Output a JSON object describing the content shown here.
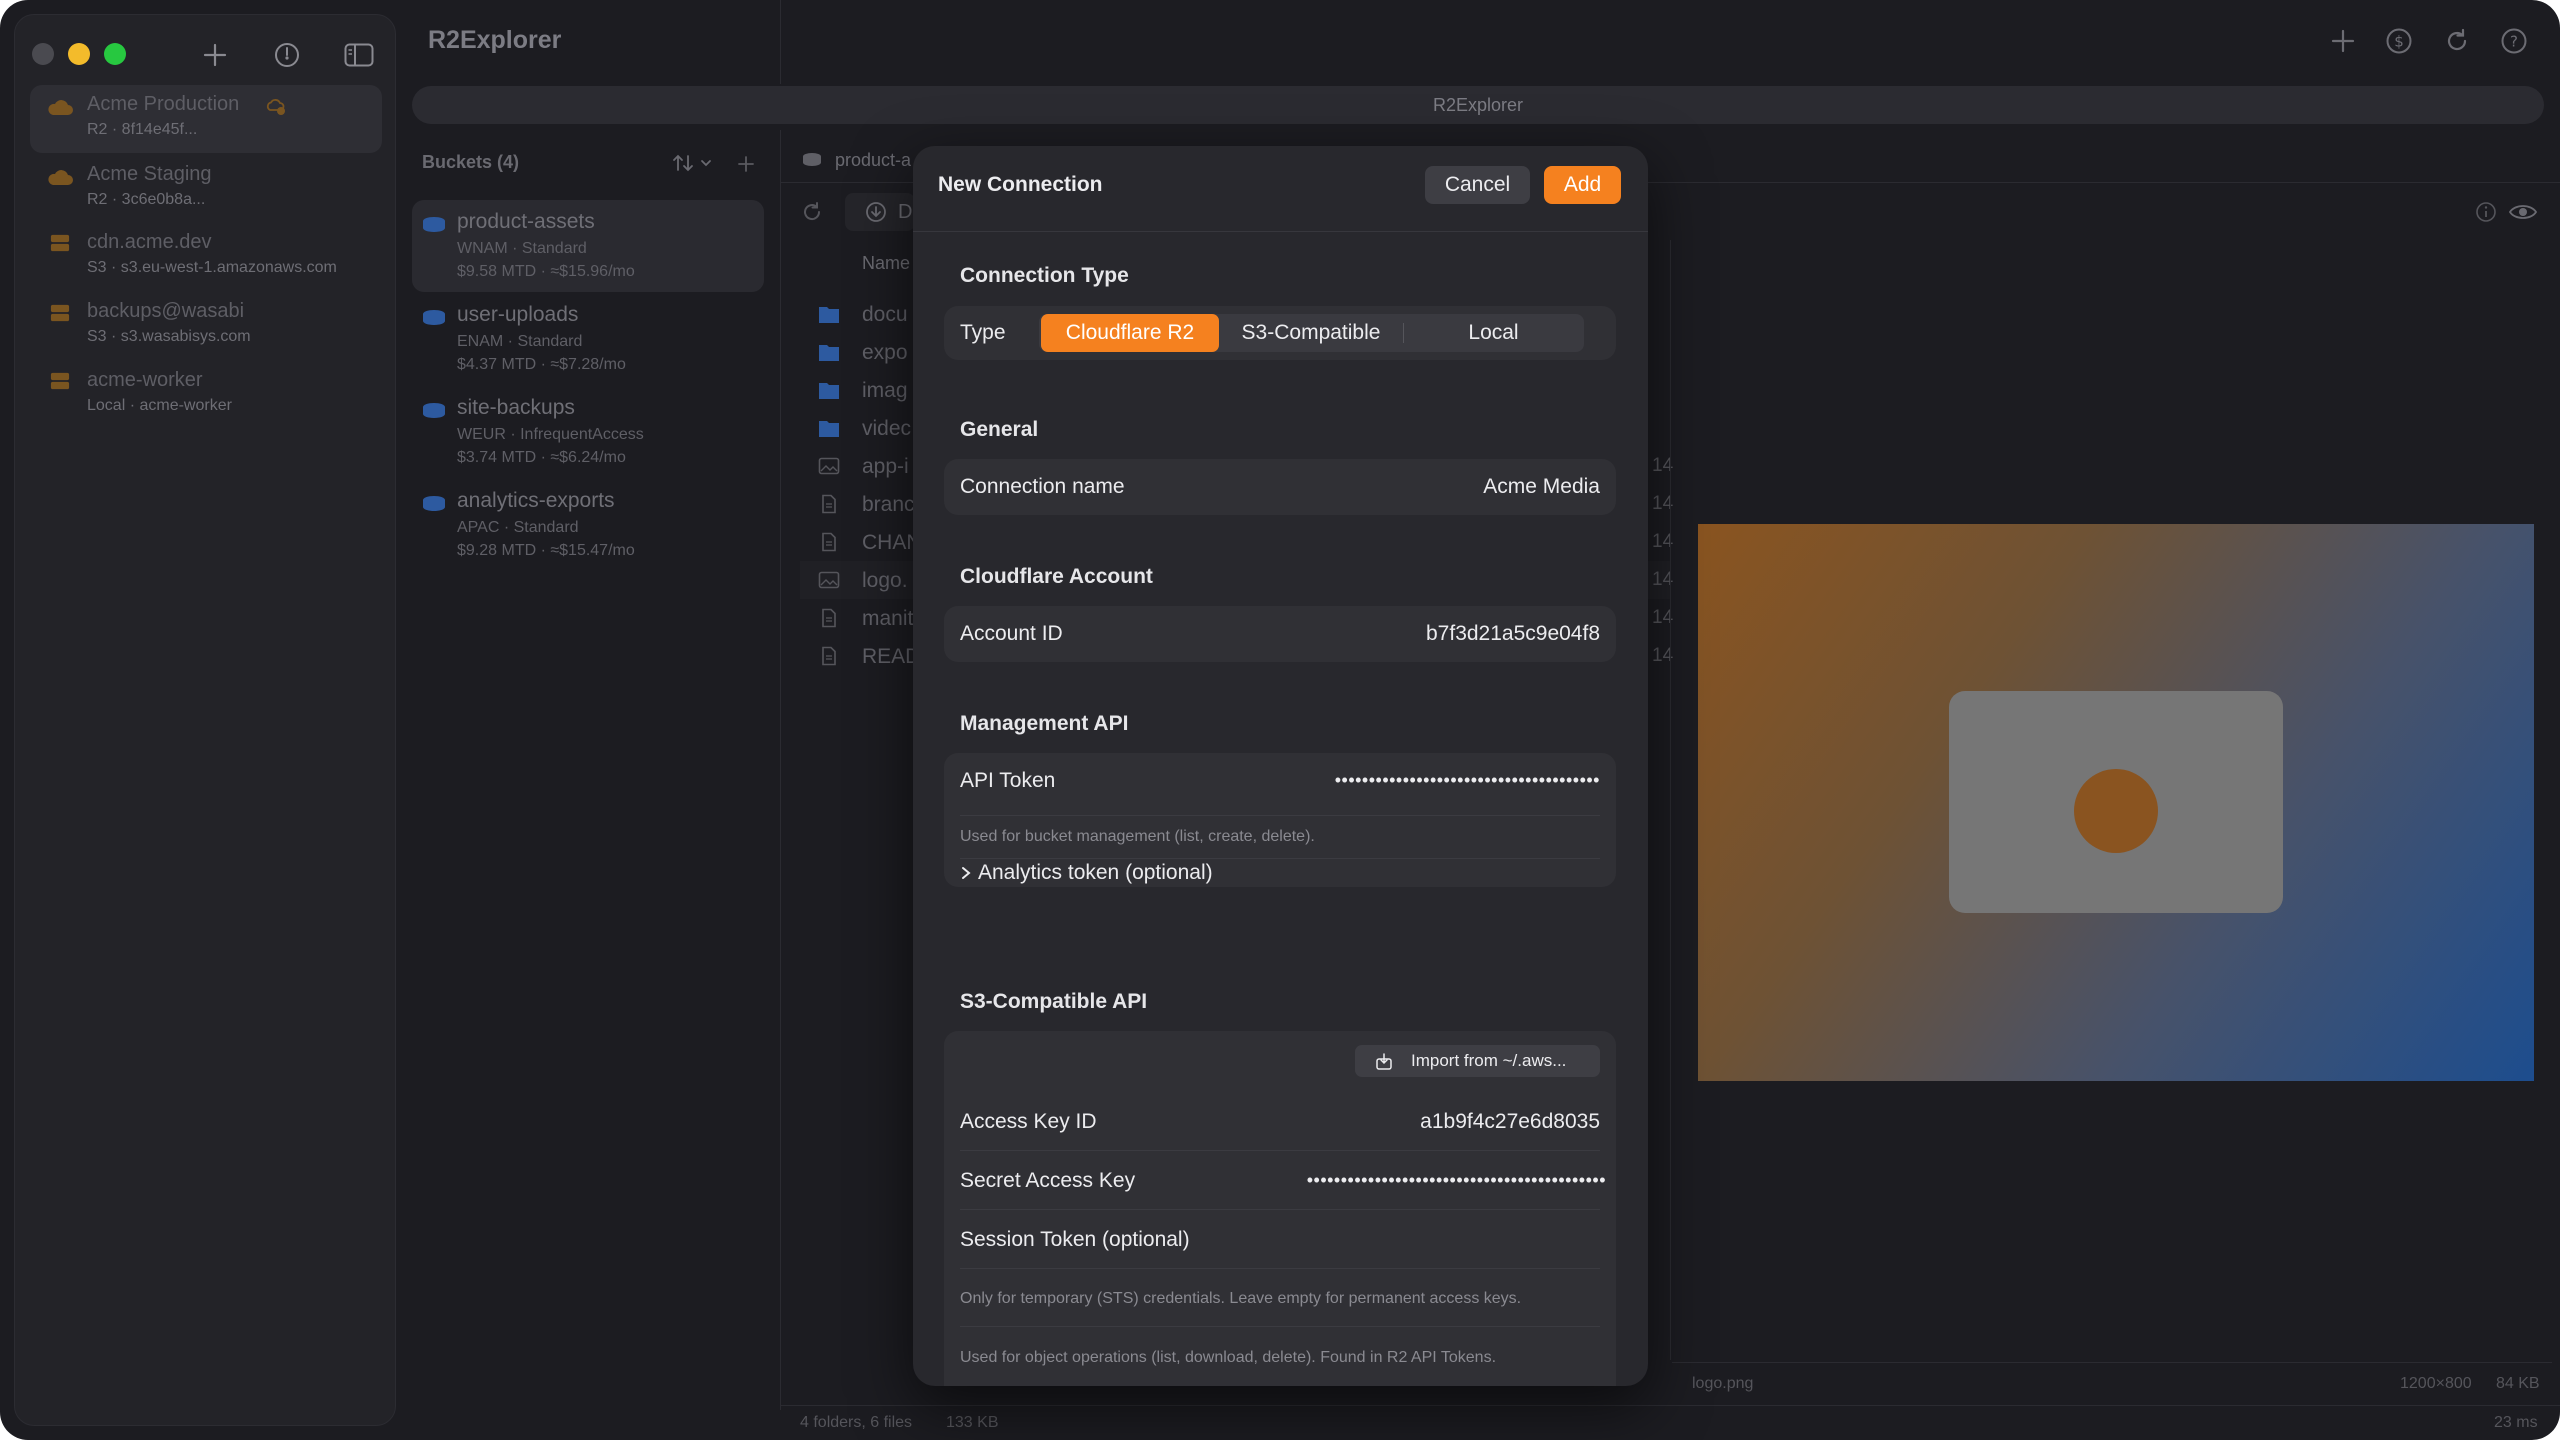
{
  "app": {
    "title": "R2Explorer",
    "path_bar": "R2Explorer"
  },
  "colors": {
    "accent": "#f5811f",
    "close": "#4a4a50",
    "minimize": "#f3bb2b",
    "zoom": "#27c840"
  },
  "sidebar": {
    "connections": [
      {
        "name": "Acme Production",
        "sub": "R2 · 8f14e45f...",
        "icon": "cloud-icon",
        "selected": true,
        "badge": "cloud-refresh-icon"
      },
      {
        "name": "Acme Staging",
        "sub": "R2 · 3c6e0b8a...",
        "icon": "cloud-icon"
      },
      {
        "name": "cdn.acme.dev",
        "sub": "S3 · s3.eu-west-1.amazonaws.com",
        "icon": "server-icon"
      },
      {
        "name": "backups@wasabi",
        "sub": "S3 · s3.wasabisys.com",
        "icon": "server-icon"
      },
      {
        "name": "acme-worker",
        "sub": "Local · acme-worker",
        "icon": "server-icon"
      }
    ]
  },
  "buckets": {
    "header": "Buckets (4)",
    "items": [
      {
        "name": "product-assets",
        "meta": "WNAM · Standard",
        "cost": "$9.58 MTD · ≈$15.96/mo"
      },
      {
        "name": "user-uploads",
        "meta": "ENAM · Standard",
        "cost": "$4.37 MTD · ≈$7.28/mo"
      },
      {
        "name": "site-backups",
        "meta": "WEUR · InfrequentAccess",
        "cost": "$3.74 MTD · ≈$6.24/mo"
      },
      {
        "name": "analytics-exports",
        "meta": "APAC · Standard",
        "cost": "$9.28 MTD · ≈$15.47/mo"
      }
    ]
  },
  "files": {
    "crumb": "product-a",
    "toolbar_letter": "D",
    "column_name": "Name",
    "rows": [
      {
        "name": "docu",
        "type": "folder",
        "num": ""
      },
      {
        "name": "expo",
        "type": "folder",
        "num": ""
      },
      {
        "name": "imag",
        "type": "folder",
        "num": ""
      },
      {
        "name": "videc",
        "type": "folder",
        "num": ""
      },
      {
        "name": "app-i",
        "type": "image",
        "num": "14"
      },
      {
        "name": "branc",
        "type": "doc",
        "num": "14"
      },
      {
        "name": "CHAN",
        "type": "doc",
        "num": "14"
      },
      {
        "name": "logo.",
        "type": "image",
        "num": "14"
      },
      {
        "name": "manit",
        "type": "doc",
        "num": "14"
      },
      {
        "name": "READ",
        "type": "doc",
        "num": "14"
      }
    ],
    "status": {
      "counts": "4 folders, 6 files",
      "size": "133 KB"
    }
  },
  "preview": {
    "filename": "logo.png",
    "dimensions": "1200×800",
    "size": "84 KB",
    "time": "23 ms"
  },
  "modal": {
    "title": "New Connection",
    "cancel": "Cancel",
    "add": "Add",
    "connection_type": {
      "title": "Connection Type",
      "label": "Type",
      "options": [
        "Cloudflare R2",
        "S3-Compatible",
        "Local"
      ],
      "selected": "Cloudflare R2"
    },
    "general": {
      "title": "General",
      "name_label": "Connection name",
      "name_value": "Acme Media"
    },
    "cloudflare": {
      "title": "Cloudflare Account",
      "account_label": "Account ID",
      "account_value": "b7f3d21a5c9e04f8"
    },
    "management": {
      "title": "Management API",
      "token_label": "API Token",
      "token_value": "•••••••••••••••••••••••••••••••••••••••",
      "hint": "Used for bucket management (list, create, delete).",
      "analytics": "Analytics token (optional)"
    },
    "s3": {
      "title": "S3-Compatible API",
      "import": "Import from ~/.aws...",
      "access_label": "Access Key ID",
      "access_value": "a1b9f4c27e6d8035",
      "secret_label": "Secret Access Key",
      "secret_value": "••••••••••••••••••••••••••••••••••••••••••••",
      "session_label": "Session Token (optional)",
      "session_hint": "Only for temporary (STS) credentials. Leave empty for permanent access keys.",
      "ops_hint": "Used for object operations (list, download, delete). Found in R2 API Tokens."
    }
  }
}
